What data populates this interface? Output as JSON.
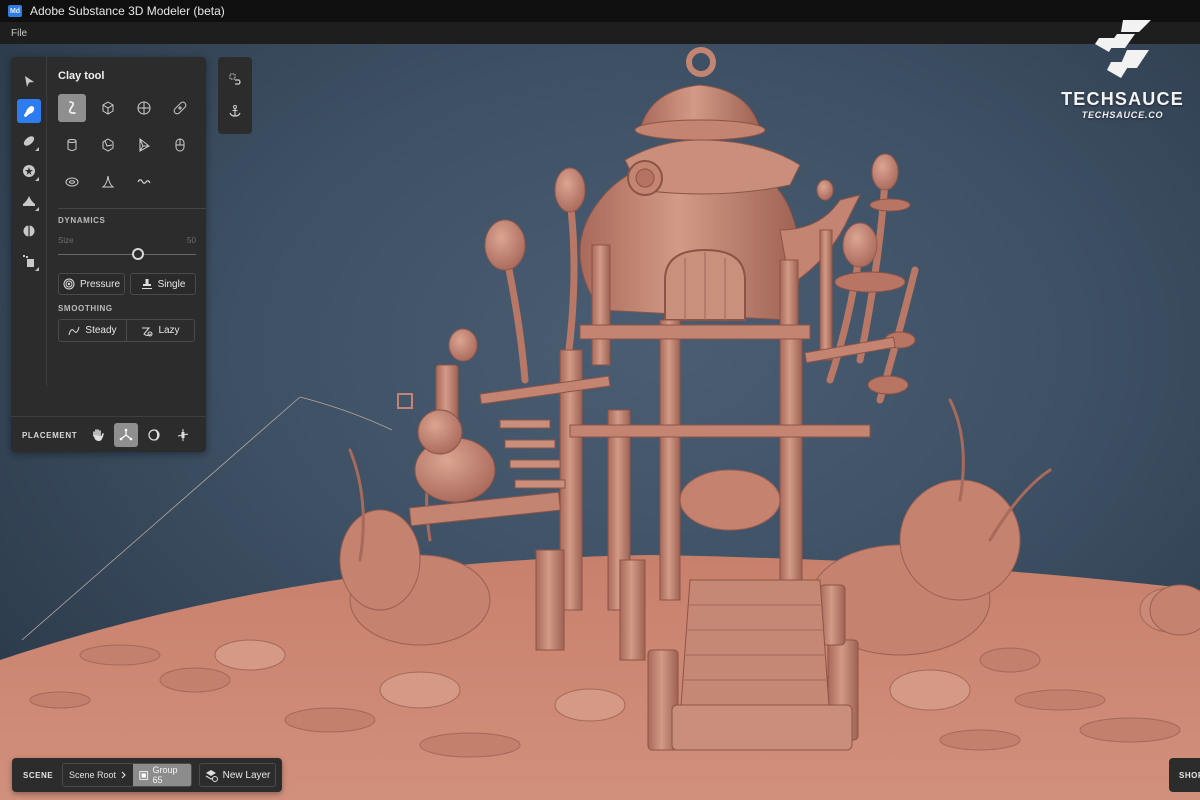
{
  "app": {
    "icon_label": "Md",
    "title": "Adobe Substance 3D Modeler (beta)"
  },
  "menu": [
    {
      "label": "File"
    }
  ],
  "tool_strip": [
    {
      "icon": "select-arrow-icon",
      "active": false
    },
    {
      "icon": "clay-brush-icon",
      "active": true
    },
    {
      "icon": "eraser-icon",
      "active": false
    },
    {
      "icon": "stamp-sphere-icon",
      "active": false
    },
    {
      "icon": "smooth-cone-icon",
      "active": false
    },
    {
      "icon": "symmetry-icon",
      "active": false
    },
    {
      "icon": "transform-icon",
      "active": false
    }
  ],
  "clay_tool": {
    "title": "Clay tool",
    "brushes": [
      {
        "icon": "clay-squiggle-icon",
        "active": true
      },
      {
        "icon": "cube-icon",
        "active": false
      },
      {
        "icon": "sphere-icon",
        "active": false
      },
      {
        "icon": "bandage-icon",
        "active": false
      },
      {
        "icon": "cylinder-icon",
        "active": false
      },
      {
        "icon": "blob-icon",
        "active": false
      },
      {
        "icon": "prism-icon",
        "active": false
      },
      {
        "icon": "capsule-icon",
        "active": false
      },
      {
        "icon": "torus-icon",
        "active": false
      },
      {
        "icon": "spike-icon",
        "active": false
      },
      {
        "icon": "wave-icon",
        "active": false
      }
    ],
    "dynamics": {
      "label": "DYNAMICS",
      "size_label": "Size",
      "size_max_label": "50",
      "size_fraction": 0.58,
      "pressure_label": "Pressure",
      "single_label": "Single"
    },
    "smoothing": {
      "label": "SMOOTHING",
      "steady_label": "Steady",
      "lazy_label": "Lazy"
    },
    "placement": {
      "label": "PLACEMENT",
      "buttons": [
        {
          "icon": "hand-icon",
          "active": false
        },
        {
          "icon": "surface-normal-icon",
          "active": true
        },
        {
          "icon": "orbit-icon",
          "active": false
        },
        {
          "icon": "axis-pin-icon",
          "active": false
        }
      ]
    }
  },
  "mini_toolbar": [
    {
      "icon": "group-select-icon"
    },
    {
      "icon": "anchor-icon"
    }
  ],
  "scene_bar": {
    "label": "SCENE",
    "crumbs": [
      {
        "label": "Scene Root",
        "active": false
      },
      {
        "label": "Group 65",
        "active": true
      }
    ],
    "new_layer_label": "New Layer"
  },
  "shortcuts_label": "SHORTCUTS",
  "watermark": {
    "name": "TECHSAUCE",
    "url": "TECHSAUCE.CO"
  },
  "colors": {
    "accent": "#2d7df0",
    "clay": "#c98a78",
    "panel": "#2c2c2c",
    "viewport_bg": "#3e5064"
  }
}
